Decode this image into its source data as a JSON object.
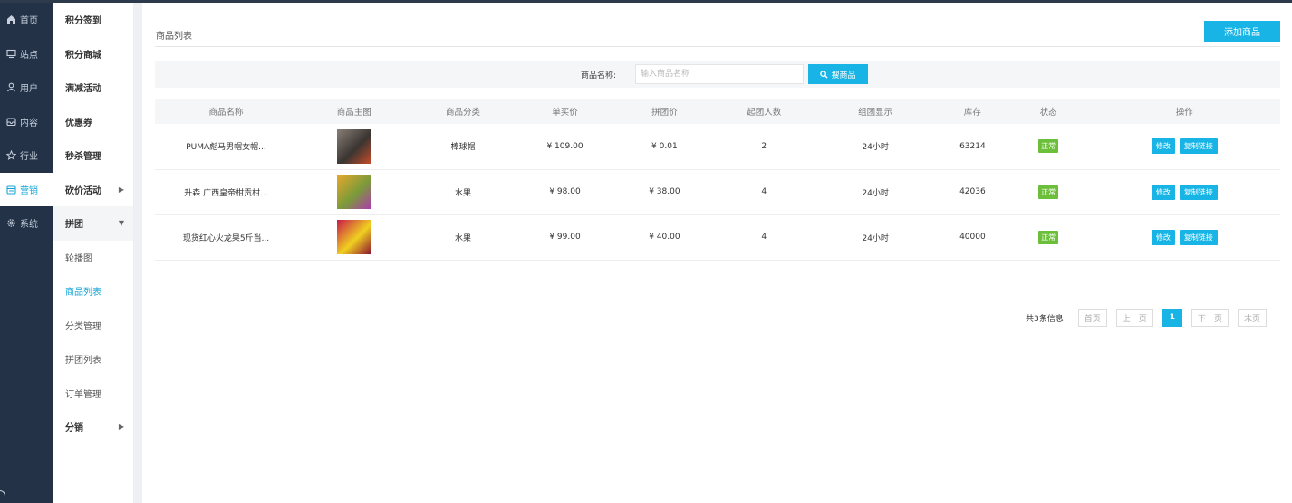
{
  "nav1": [
    {
      "icon": "home-icon",
      "label": "首页"
    },
    {
      "icon": "monitor-icon",
      "label": "站点"
    },
    {
      "icon": "user-icon",
      "label": "用户"
    },
    {
      "icon": "inbox-icon",
      "label": "内容"
    },
    {
      "icon": "star-icon",
      "label": "行业"
    },
    {
      "icon": "calendar-icon",
      "label": "营销",
      "active": true
    },
    {
      "icon": "gear-icon",
      "label": "系统"
    }
  ],
  "nav2": [
    {
      "label": "积分签到"
    },
    {
      "label": "积分商城"
    },
    {
      "label": "满减活动"
    },
    {
      "label": "优惠券"
    },
    {
      "label": "秒杀管理"
    },
    {
      "label": "砍价活动",
      "caret": "right"
    },
    {
      "label": "拼团",
      "caret": "down",
      "open": true
    },
    {
      "label": "轮播图",
      "sub": true
    },
    {
      "label": "商品列表",
      "sub": true,
      "selected": true
    },
    {
      "label": "分类管理",
      "sub": true
    },
    {
      "label": "拼团列表",
      "sub": true
    },
    {
      "label": "订单管理",
      "sub": true
    },
    {
      "label": "分销",
      "caret": "right"
    }
  ],
  "page": {
    "title": "商品列表",
    "add_button": "添加商品"
  },
  "search": {
    "label": "商品名称:",
    "placeholder": "输入商品名称",
    "button": "搜商品"
  },
  "table": {
    "headers": [
      "商品名称",
      "商品主图",
      "商品分类",
      "单买价",
      "拼团价",
      "起团人数",
      "组团显示",
      "库存",
      "状态",
      "操作"
    ],
    "rows": [
      {
        "name": "PUMA彪马男帽女帽...",
        "category": "棒球帽",
        "price": "¥ 109.00",
        "group_price": "¥ 0.01",
        "min_people": "2",
        "display": "24小时",
        "stock": "63214",
        "status": "正常",
        "thumb_colors": [
          "#8a7f78",
          "#3a3532",
          "#c94c2a"
        ]
      },
      {
        "name": "升森 广西皇帝柑贡柑...",
        "category": "水果",
        "price": "¥ 98.00",
        "group_price": "¥ 38.00",
        "min_people": "4",
        "display": "24小时",
        "stock": "42036",
        "status": "正常",
        "thumb_colors": [
          "#e8a82a",
          "#7a9a3a",
          "#b03ab0"
        ]
      },
      {
        "name": "现货红心火龙果5斤当...",
        "category": "水果",
        "price": "¥ 99.00",
        "group_price": "¥ 40.00",
        "min_people": "4",
        "display": "24小时",
        "stock": "40000",
        "status": "正常",
        "thumb_colors": [
          "#c8184a",
          "#f0d020",
          "#8a1030"
        ]
      }
    ],
    "actions": [
      "修改",
      "复制链接"
    ]
  },
  "pager": {
    "info": "共3条信息",
    "first": "首页",
    "prev": "上一页",
    "current": "1",
    "next": "下一页",
    "last": "末页"
  },
  "colors": {
    "accent": "#17b4e5",
    "sidebar": "#233247",
    "status_ok": "#6cbf3a"
  }
}
